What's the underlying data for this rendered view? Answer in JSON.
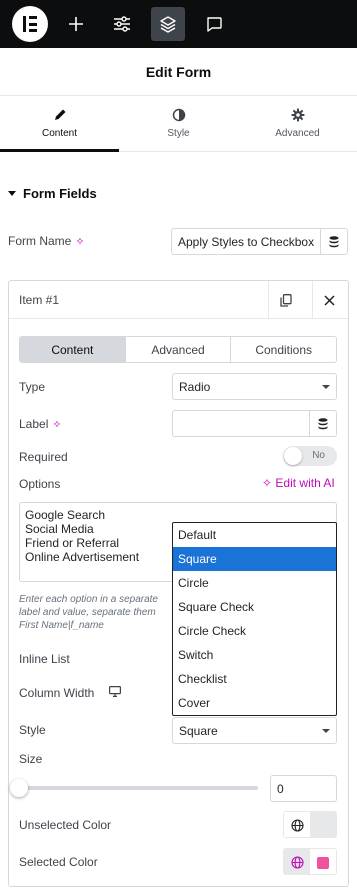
{
  "topbar": {
    "icons": [
      "elementor-logo-icon",
      "plus-icon",
      "sliders-icon",
      "layers-icon",
      "chat-icon"
    ]
  },
  "header": {
    "title": "Edit Form"
  },
  "tabs": [
    {
      "label": "Content",
      "icon": "pencil-icon",
      "active": true
    },
    {
      "label": "Style",
      "icon": "half-circle-icon",
      "active": false
    },
    {
      "label": "Advanced",
      "icon": "gear-icon",
      "active": false
    }
  ],
  "section": {
    "title": "Form Fields"
  },
  "form_name": {
    "label": "Form Name",
    "value": "Apply Styles to Checkbox"
  },
  "item": {
    "title": "Item #1",
    "subtabs": [
      {
        "label": "Content",
        "active": true
      },
      {
        "label": "Advanced",
        "active": false
      },
      {
        "label": "Conditions",
        "active": false
      }
    ],
    "type": {
      "label": "Type",
      "value": "Radio"
    },
    "field_label": {
      "label": "Label",
      "value": ""
    },
    "required": {
      "label": "Required",
      "state": "No"
    },
    "options": {
      "label": "Options",
      "ai_link": "Edit with AI",
      "lines": [
        "Google Search",
        "Social Media",
        "Friend or Referral",
        "Online Advertisement"
      ],
      "help": [
        "Enter each option in a separate",
        "label and value, separate them",
        "First Name|f_name"
      ]
    },
    "inline_list": {
      "label": "Inline List"
    },
    "column_width": {
      "label": "Column Width"
    },
    "style": {
      "label": "Style",
      "value": "Square",
      "options": [
        "Default",
        "Square",
        "Circle",
        "Square Check",
        "Circle Check",
        "Switch",
        "Checklist",
        "Cover"
      ],
      "selected": "Square"
    },
    "size": {
      "label": "Size",
      "value": "0"
    },
    "unselected_color": {
      "label": "Unselected Color",
      "swatch": "#e6e8ea"
    },
    "selected_color": {
      "label": "Selected Color",
      "swatch": "#f0539d",
      "globe": "#c00bb9"
    }
  },
  "colors": {
    "accent_ai": "#c00bb9",
    "selection": "#1a73d6"
  }
}
